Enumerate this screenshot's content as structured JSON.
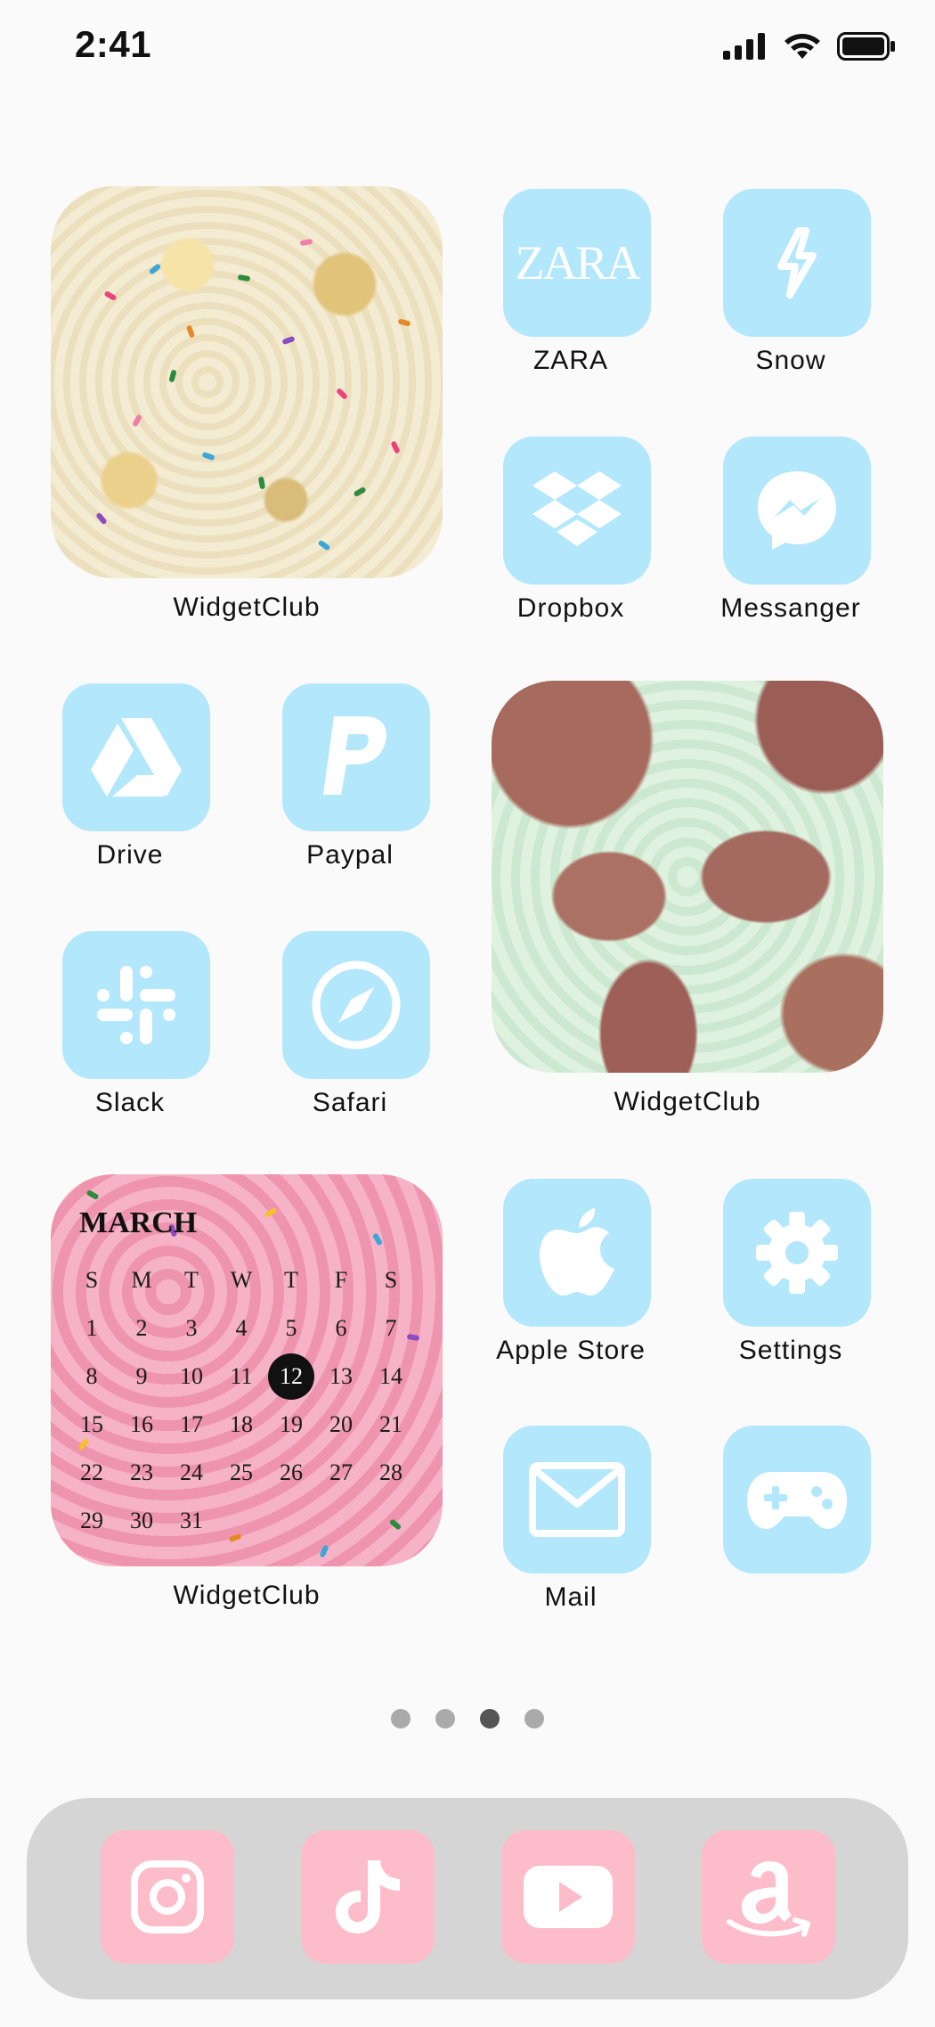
{
  "status_bar": {
    "time": "2:41"
  },
  "apps": {
    "zara": {
      "label": "ZARA",
      "logo_text": "ZARA"
    },
    "snow": {
      "label": "Snow"
    },
    "dropbox": {
      "label": "Dropbox"
    },
    "messenger": {
      "label": "Messanger"
    },
    "drive": {
      "label": "Drive"
    },
    "paypal": {
      "label": "Paypal"
    },
    "slack": {
      "label": "Slack"
    },
    "safari": {
      "label": "Safari"
    },
    "apple_store": {
      "label": "Apple Store"
    },
    "settings": {
      "label": "Settings"
    },
    "mail": {
      "label": "Mail"
    },
    "game": {
      "label": ""
    }
  },
  "widgets": {
    "photo1": {
      "label": "WidgetClub"
    },
    "photo2": {
      "label": "WidgetClub"
    },
    "calendar": {
      "label": "WidgetClub",
      "month": "MARCH",
      "weekdays": [
        "S",
        "M",
        "T",
        "W",
        "T",
        "F",
        "S"
      ],
      "weeks": [
        [
          "1",
          "2",
          "3",
          "4",
          "5",
          "6",
          "7"
        ],
        [
          "8",
          "9",
          "10",
          "11",
          "12",
          "13",
          "14"
        ],
        [
          "15",
          "16",
          "17",
          "18",
          "19",
          "20",
          "21"
        ],
        [
          "22",
          "23",
          "24",
          "25",
          "26",
          "27",
          "28"
        ],
        [
          "29",
          "30",
          "31",
          "",
          "",
          "",
          ""
        ]
      ],
      "today": "12"
    }
  },
  "page_indicator": {
    "pages": 4,
    "current": 3
  },
  "dock": [
    "instagram",
    "tiktok",
    "youtube",
    "amazon"
  ],
  "colors": {
    "tile": "#b3e7fb",
    "dock_tile": "#fdbcc9",
    "dock_bg": "#d5d5d5"
  }
}
